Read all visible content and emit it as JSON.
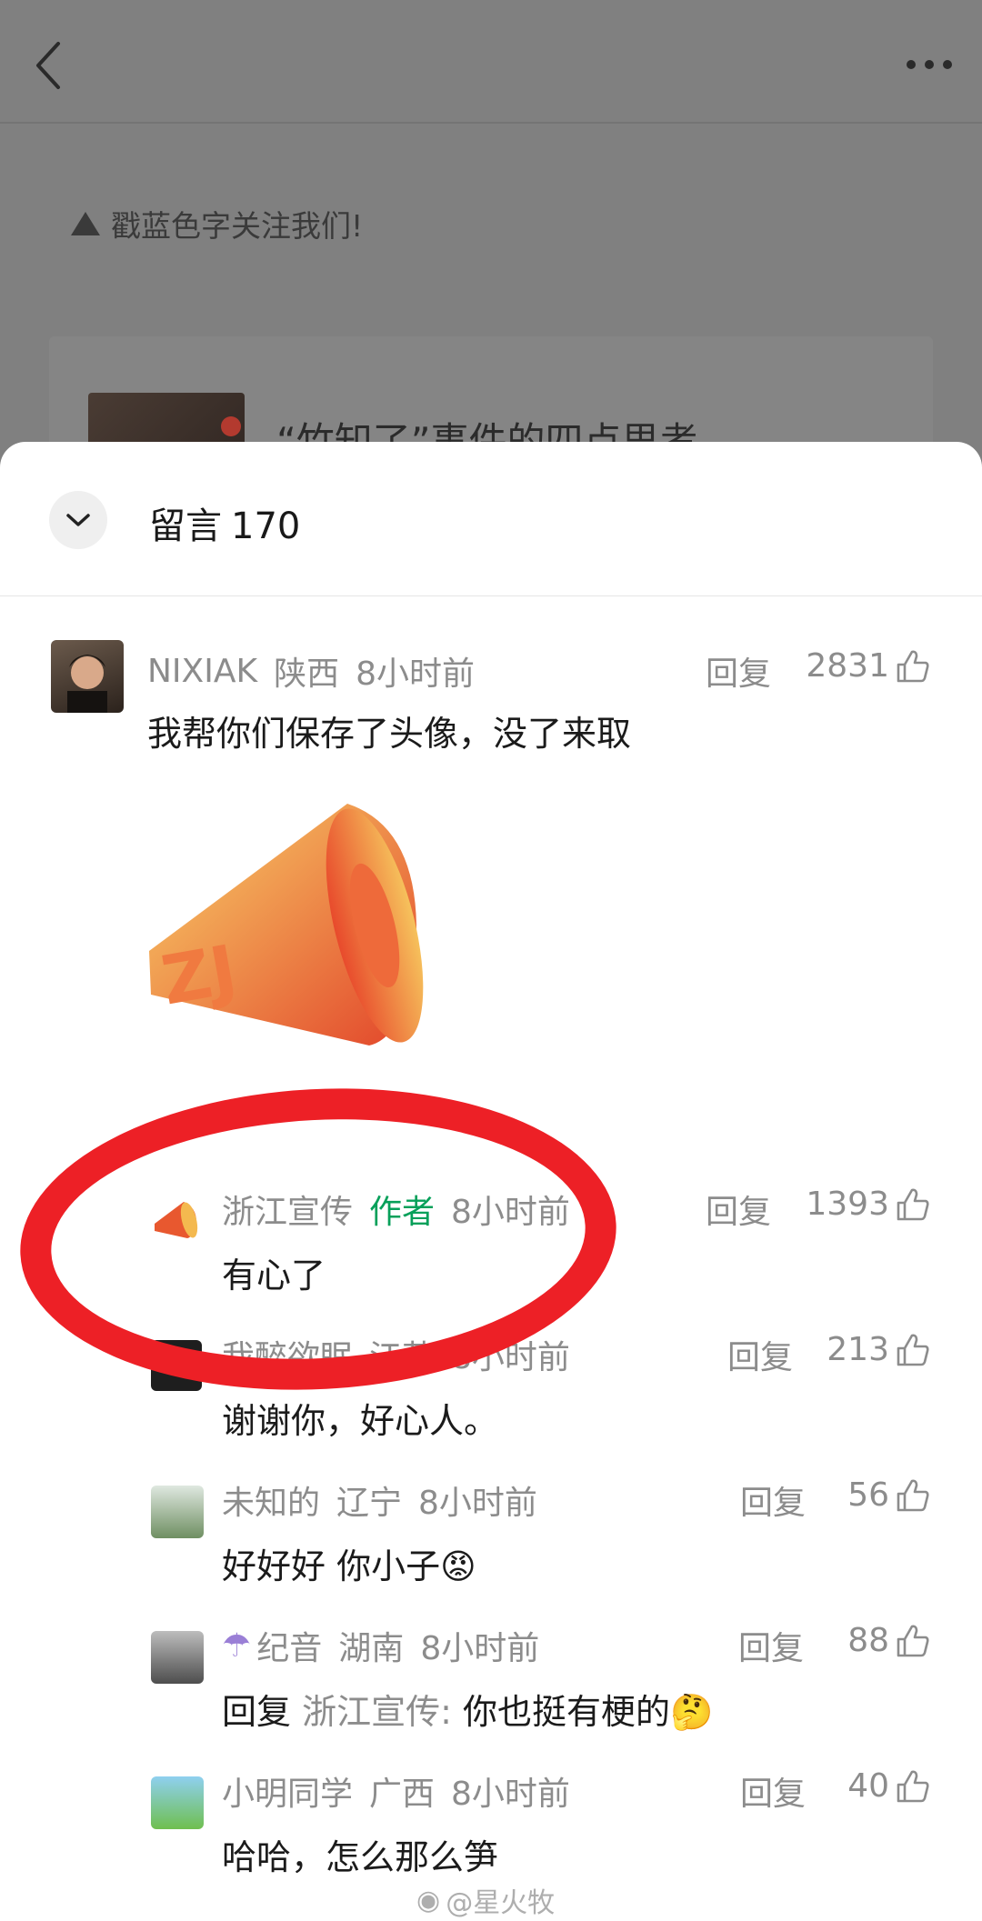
{
  "article": {
    "follow_tip": "戳蓝色字关注我们!",
    "card_title": "“竹知了”事件的四点思考"
  },
  "sheet": {
    "title_label": "留言",
    "title_count": "170"
  },
  "comments": [
    {
      "user": "NIXIAK",
      "region": "陕西",
      "time": "8小时前",
      "reply_label": "回复",
      "likes": "2831",
      "text": "我帮你们保存了头像，没了来取",
      "has_image": true
    },
    {
      "user": "浙江宣传",
      "author_tag": "作者",
      "time": "8小时前",
      "reply_label": "回复",
      "likes": "1393",
      "text": "有心了"
    },
    {
      "user": "我醉欲眠",
      "region": "江苏",
      "time": "8小时前",
      "reply_label": "回复",
      "likes": "213",
      "text": "谢谢你，好心人。"
    },
    {
      "user": "未知的",
      "region": "辽宁",
      "time": "8小时前",
      "reply_label": "回复",
      "likes": "56",
      "text": "好好好 你小子😡"
    },
    {
      "user": "纪音",
      "region": "湖南",
      "time": "8小时前",
      "reply_label": "回复",
      "likes": "88",
      "text_prefix": "回复",
      "text_mention": "浙江宣传:",
      "text": "你也挺有梗的🤔"
    },
    {
      "user": "小明同学",
      "region": "广西",
      "time": "8小时前",
      "reply_label": "回复",
      "likes": "40",
      "text": "哈哈，怎么那么笋"
    }
  ],
  "watermark": "@星火牧",
  "icons": {
    "back": "chevron-left-icon",
    "more": "more-dots-icon",
    "collapse": "chevron-down-icon",
    "like": "thumbs-up-icon",
    "megaphone": "megaphone-icon"
  },
  "colors": {
    "author_tag": "#07a05a",
    "annotation": "#ed2026",
    "secondary_text": "#8c8c8c"
  }
}
